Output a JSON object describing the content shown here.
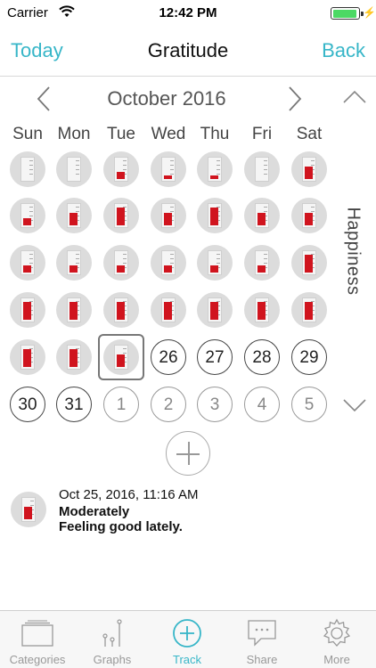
{
  "status": {
    "carrier": "Carrier",
    "time": "12:42 PM"
  },
  "nav": {
    "left": "Today",
    "title": "Gratitude",
    "right": "Back"
  },
  "calendar": {
    "month": "October 2016",
    "weekdays": [
      "Sun",
      "Mon",
      "Tue",
      "Wed",
      "Thu",
      "Fri",
      "Sat"
    ],
    "side_label": "Happiness",
    "weeks": [
      [
        {
          "level": 0
        },
        {
          "level": 0
        },
        {
          "level": 0.35
        },
        {
          "level": 0.15
        },
        {
          "level": 0.15
        },
        {
          "level": 0
        },
        {
          "level": 0.6
        }
      ],
      [
        {
          "level": 0.35
        },
        {
          "level": 0.6
        },
        {
          "level": 0.85
        },
        {
          "level": 0.6
        },
        {
          "level": 0.85
        },
        {
          "level": 0.6
        },
        {
          "level": 0.6
        }
      ],
      [
        {
          "level": 0.35
        },
        {
          "level": 0.35
        },
        {
          "level": 0.35
        },
        {
          "level": 0.35
        },
        {
          "level": 0.35
        },
        {
          "level": 0.35
        },
        {
          "level": 0.85
        }
      ],
      [
        {
          "level": 0.85
        },
        {
          "level": 0.85
        },
        {
          "level": 0.85
        },
        {
          "level": 0.85
        },
        {
          "level": 0.85
        },
        {
          "level": 0.85
        },
        {
          "level": 0.85
        }
      ],
      [
        {
          "level": 0.85
        },
        {
          "level": 0.85
        },
        {
          "level": 0.6,
          "selected": true
        },
        {
          "day": "26"
        },
        {
          "day": "27"
        },
        {
          "day": "28"
        },
        {
          "day": "29"
        }
      ],
      [
        {
          "day": "30"
        },
        {
          "day": "31"
        },
        {
          "day": "1",
          "future": true
        },
        {
          "day": "2",
          "future": true
        },
        {
          "day": "3",
          "future": true
        },
        {
          "day": "4",
          "future": true
        },
        {
          "day": "5",
          "future": true
        }
      ]
    ]
  },
  "entry": {
    "datetime": "Oct 25, 2016, 11:16 AM",
    "level_text": "Moderately",
    "note": "Feeling good lately.",
    "level": 0.6
  },
  "tabs": [
    {
      "label": "Categories",
      "icon": "categories-icon"
    },
    {
      "label": "Graphs",
      "icon": "graphs-icon"
    },
    {
      "label": "Track",
      "icon": "track-plus-icon",
      "active": true
    },
    {
      "label": "Share",
      "icon": "share-message-icon"
    },
    {
      "label": "More",
      "icon": "more-gear-icon"
    }
  ],
  "colors": {
    "accent": "#37b6c8",
    "level": "#d0141e",
    "cell_bg": "#dcdcdc"
  }
}
